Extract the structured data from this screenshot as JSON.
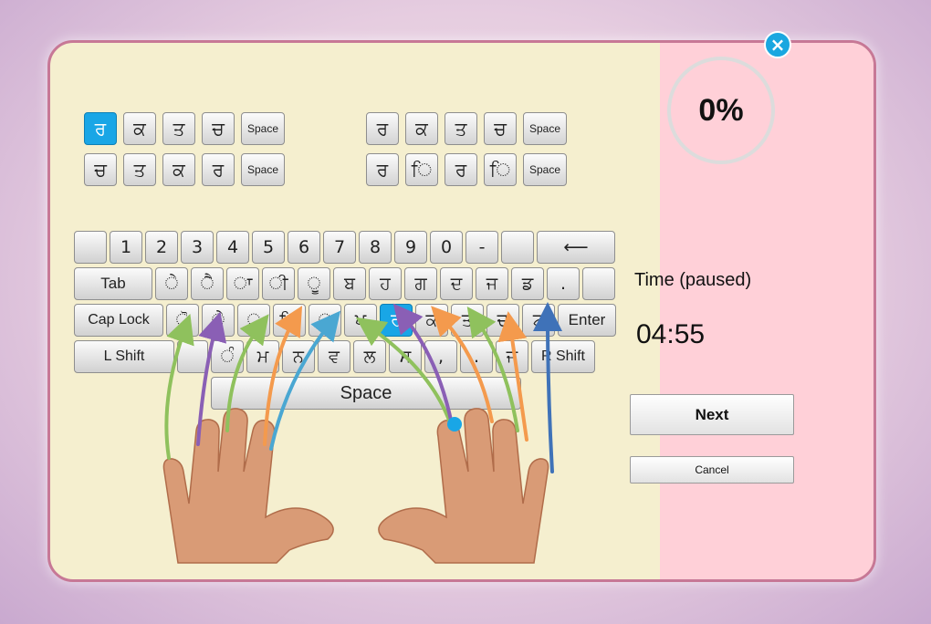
{
  "drill": {
    "rows": [
      [
        "ਰ",
        "ਕ",
        "ਤ",
        "ਚ",
        "Space"
      ],
      [
        "ਚ",
        "ਤ",
        "ਕ",
        "ਰ",
        "Space"
      ],
      [
        "ਰ",
        "ਕ",
        "ਤ",
        "ਚ",
        "Space"
      ],
      [
        "ਰ",
        "ਿ",
        "ਰ",
        "ਿ",
        "Space"
      ]
    ]
  },
  "keyboard": {
    "row1": [
      "",
      "1",
      "2",
      "3",
      "4",
      "5",
      "6",
      "7",
      "8",
      "9",
      "0",
      "-",
      "",
      ""
    ],
    "row2": [
      "Tab",
      "ੇ",
      "ੈ",
      "ਾ",
      "ੀ",
      "ੂ",
      "ਬ",
      "ਹ",
      "ਗ",
      "ਦ",
      "ਜ",
      "ਡ",
      ".",
      ""
    ],
    "row3": [
      "Cap Lock",
      "ੋ",
      "ੇ",
      "੍",
      "ਿ",
      "ੁ",
      "ਪ",
      "ਰ",
      "ਕ",
      "ਤ",
      "ਚ",
      "ਟ",
      "Enter"
    ],
    "row4": [
      "L Shift",
      "",
      "ੰ",
      "ਮ",
      "ਨ",
      "ਵ",
      "ਲ",
      "ਸ",
      ",",
      ".",
      "ਜ",
      "R Shift"
    ],
    "space": "Space",
    "backspace": "⟵"
  },
  "side": {
    "close_icon": "×",
    "progress": "0%",
    "progress_value": 0,
    "time_label": "Time (paused)",
    "time_value": "04:55",
    "next_label": "Next",
    "cancel_label": "Cancel"
  },
  "colors": {
    "accent": "#19a6e6",
    "panel": "#f5efcf",
    "side_panel": "#ffd0d8",
    "border": "#c77896",
    "finger_green": "#8fc15d",
    "finger_purple": "#8a5fb5",
    "finger_orange": "#f49a4d",
    "finger_blue": "#4aa7d2",
    "finger_navy": "#3f72b8"
  }
}
